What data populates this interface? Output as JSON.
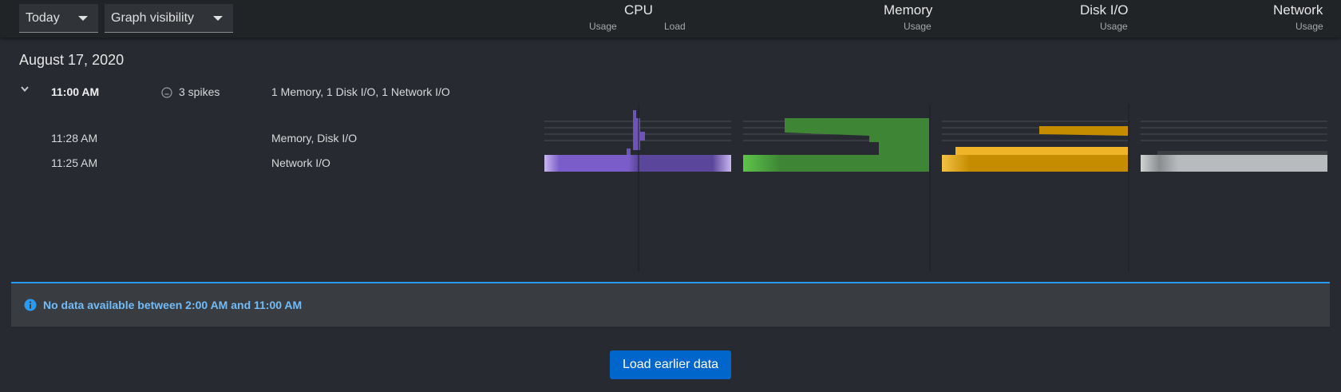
{
  "toolbar": {
    "time_select": "Today",
    "visibility_select": "Graph visibility"
  },
  "columns": {
    "cpu": {
      "title": "CPU",
      "sub_usage": "Usage",
      "sub_load": "Load"
    },
    "memory": {
      "title": "Memory",
      "sub": "Usage"
    },
    "disk": {
      "title": "Disk I/O",
      "sub": "Usage"
    },
    "network": {
      "title": "Network",
      "sub": "Usage"
    }
  },
  "day": {
    "date": "August 17, 2020",
    "group": {
      "time": "11:00 AM",
      "spikes": "3 spikes",
      "summary": "1 Memory, 1 Disk I/O, 1 Network I/O"
    },
    "events": [
      {
        "time": "11:28 AM",
        "metrics": "Memory, Disk I/O"
      },
      {
        "time": "11:25 AM",
        "metrics": "Network I/O"
      }
    ]
  },
  "colors": {
    "cpu": "#7b5dc9",
    "memory": "#3e8635",
    "disk": "#c58c00",
    "network": "#b8bbbe",
    "accent": "#2b9af3",
    "button": "#0066cc"
  },
  "alert": {
    "icon": "info-icon",
    "text": "No data available between 2:00 AM and 11:00 AM"
  },
  "load_button": "Load earlier data"
}
